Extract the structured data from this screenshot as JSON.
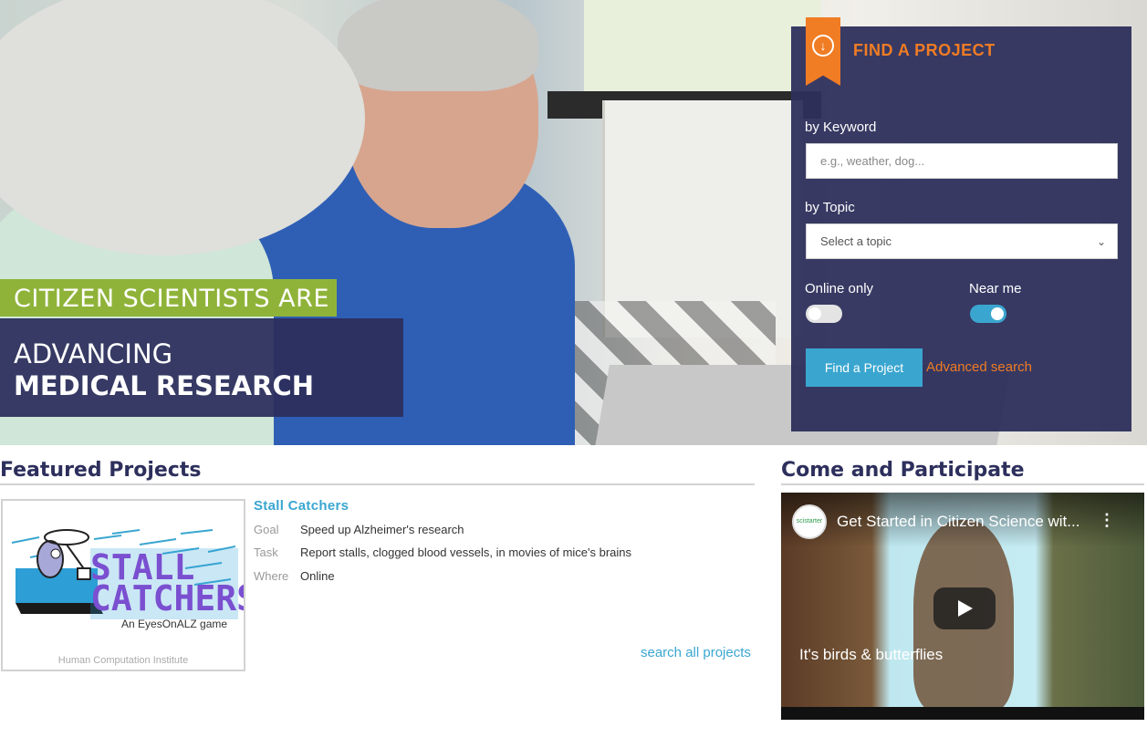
{
  "hero": {
    "tagline_top": "CITIZEN SCIENTISTS ARE",
    "tagline_line1": "ADVANCING",
    "tagline_line2": "MEDICAL RESEARCH"
  },
  "finder": {
    "title": "FIND A PROJECT",
    "ribbon_icon": "arrow-down-circle-icon",
    "keyword_label": "by Keyword",
    "keyword_placeholder": "e.g., weather, dog...",
    "topic_label": "by Topic",
    "topic_value": "Select a topic",
    "online_label": "Online only",
    "online_on": false,
    "near_label": "Near me",
    "near_on": true,
    "find_button": "Find a Project",
    "advanced_link": "Advanced search",
    "colors": {
      "accent": "#f07c24",
      "panel": "#2d2f5c",
      "button": "#3aa6d0"
    }
  },
  "featured": {
    "heading": "Featured Projects",
    "project": {
      "title": "Stall Catchers",
      "logo_text_line1": "STALL",
      "logo_text_line2": "CATCHERS",
      "logo_sub": "An EyesOnALZ game",
      "credit": "Human Computation Institute",
      "rows": [
        {
          "key": "Goal",
          "value": "Speed up Alzheimer's research"
        },
        {
          "key": "Task",
          "value": "Report stalls, clogged blood vessels, in movies of mice's brains"
        },
        {
          "key": "Where",
          "value": "Online"
        }
      ]
    },
    "search_all": "search all projects"
  },
  "participate": {
    "heading": "Come and Participate",
    "video": {
      "channel": "scistarter",
      "title": "Get Started in Citizen Science wit...",
      "caption": "It's birds & butterflies",
      "menu_icon": "more-vertical-icon",
      "play_icon": "play-icon"
    }
  }
}
